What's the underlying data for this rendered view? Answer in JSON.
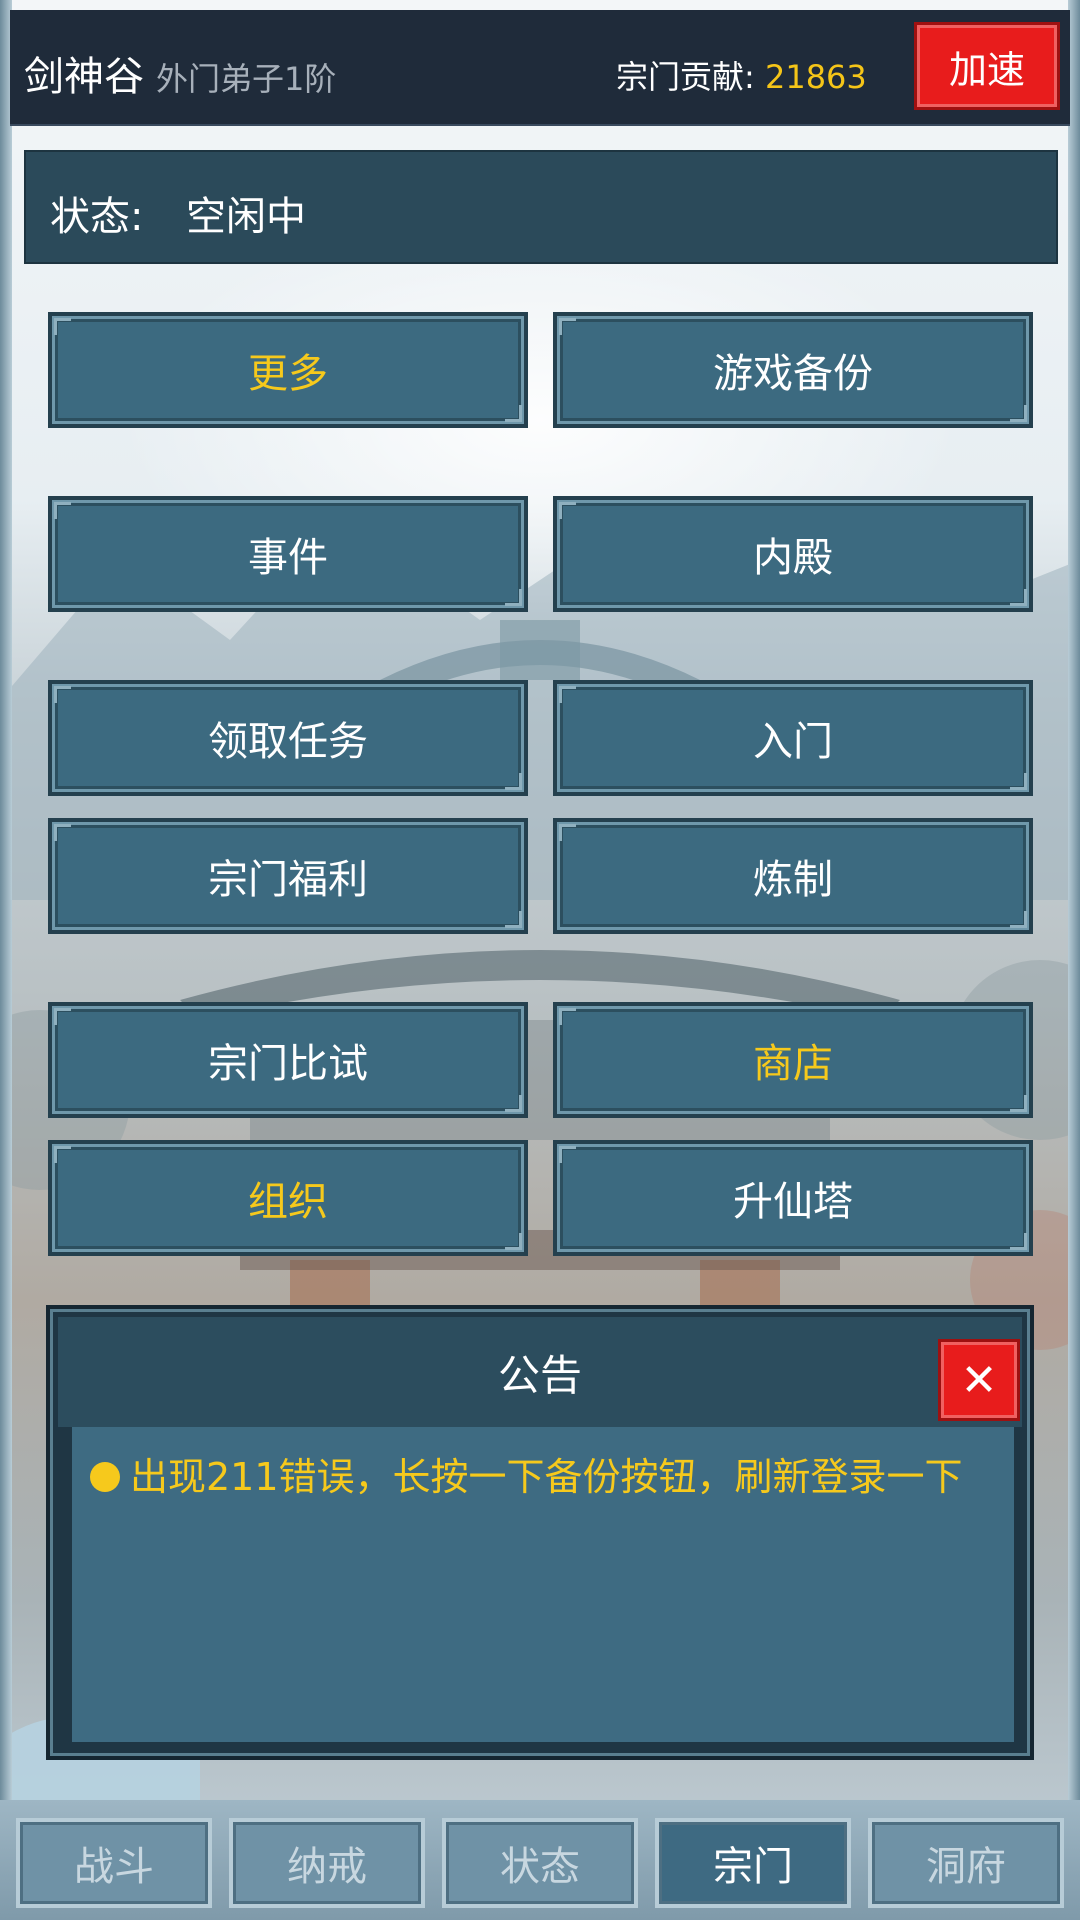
{
  "header": {
    "sect_name": "剑神谷",
    "rank": "外门弟子1阶",
    "contribution_label": "宗门贡献: ",
    "contribution_value": "21863",
    "speed_button": "加速"
  },
  "status": {
    "label": "状态:",
    "value": "空闲中"
  },
  "menu": {
    "more": "更多",
    "backup": "游戏备份",
    "events": "事件",
    "inner_hall": "内殿",
    "tasks": "领取任务",
    "enter": "入门",
    "welfare": "宗门福利",
    "refine": "炼制",
    "contest": "宗门比试",
    "shop": "商店",
    "organization": "组织",
    "tower": "升仙塔"
  },
  "notice": {
    "title": "公告",
    "close_icon": "close-icon",
    "message": "出现211错误，长按一下备份按钮，刷新登录一下"
  },
  "bottom_nav": {
    "battle": "战斗",
    "ring": "纳戒",
    "status": "状态",
    "sect": "宗门",
    "cave": "洞府",
    "active": "宗门"
  },
  "colors": {
    "accent_gold": "#f6c91c",
    "button_red": "#e81c1c",
    "button_teal": "#3c6a80",
    "header_dark": "#1f2b3a"
  }
}
